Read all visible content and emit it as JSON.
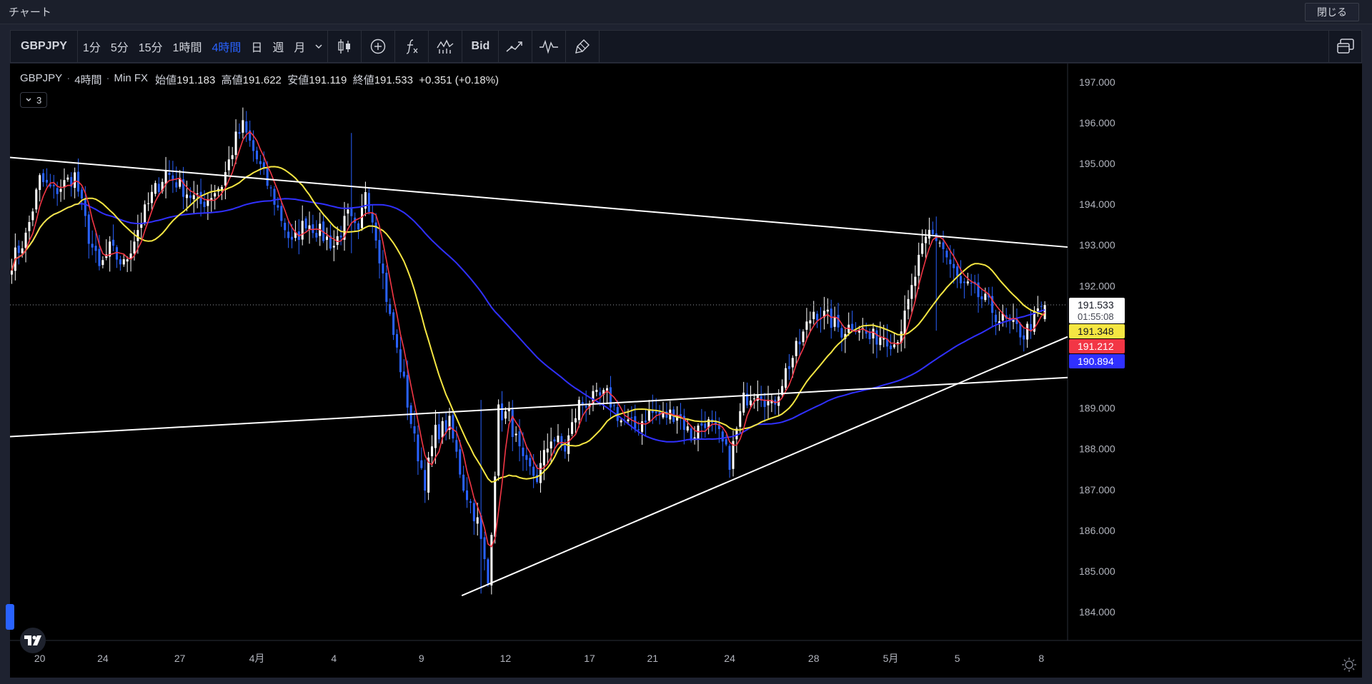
{
  "window": {
    "title": "チャート",
    "close_label": "閉じる"
  },
  "toolbar": {
    "symbol": "GBPJPY",
    "intervals": [
      "1分",
      "5分",
      "15分",
      "1時間",
      "4時間",
      "日",
      "週",
      "月"
    ],
    "active_interval": "4時間",
    "interval_dropdown_icon": "chevron-down-icon",
    "chart_type_icon": "candlestick-icon",
    "add_icon": "plus-circle-icon",
    "indicators_icon": "function-icon",
    "templates_icon": "indicator-templates-icon",
    "bid_label": "Bid",
    "compare_icon": "compare-icon",
    "replay_icon": "bar-replay-icon",
    "clear_icon": "brush-icon",
    "layout_icon": "window-layout-icon"
  },
  "legend": {
    "symbol": "GBPJPY",
    "interval": "4時間",
    "source": "Min FX",
    "open_label": "始値",
    "open": "191.183",
    "high_label": "高値",
    "high": "191.622",
    "low_label": "安値",
    "low": "191.119",
    "close_label": "終値",
    "close": "191.533",
    "change": "+0.351",
    "change_pct": "(+0.18%)",
    "collapse_count": "3"
  },
  "colors": {
    "up": "#ffffff",
    "down": "#2962ff",
    "ma_fast": "#f23645",
    "ma_mid": "#f5e642",
    "ma_slow": "#3030ff",
    "trendline": "#ffffff"
  },
  "chart_data": {
    "type": "candlestick",
    "symbol": "GBPJPY",
    "interval": "4時間",
    "y_ticks": [
      "197.000",
      "196.000",
      "195.000",
      "194.000",
      "193.000",
      "192.000",
      "189.000",
      "188.000",
      "187.000",
      "186.000",
      "185.000",
      "184.000"
    ],
    "ylim": [
      183.3,
      197.4
    ],
    "x_ticks": [
      {
        "label": "20",
        "i": 8
      },
      {
        "label": "24",
        "i": 26
      },
      {
        "label": "27",
        "i": 48
      },
      {
        "label": "4月",
        "i": 70
      },
      {
        "label": "4",
        "i": 92
      },
      {
        "label": "9",
        "i": 117
      },
      {
        "label": "12",
        "i": 141
      },
      {
        "label": "17",
        "i": 165
      },
      {
        "label": "21",
        "i": 183
      },
      {
        "label": "24",
        "i": 205
      },
      {
        "label": "28",
        "i": 229
      },
      {
        "label": "5月",
        "i": 251
      },
      {
        "label": "5",
        "i": 270
      },
      {
        "label": "8",
        "i": 294
      }
    ],
    "price_labels": [
      {
        "name": "last",
        "value": "191.533",
        "countdown": "01:55:08"
      },
      {
        "name": "ma-mid",
        "value": "191.348"
      },
      {
        "name": "ma-fast",
        "value": "191.212"
      },
      {
        "name": "ma-slow",
        "value": "190.894"
      }
    ],
    "trendlines": [
      {
        "name": "upper-resistance",
        "from": [
          0,
          195.15
        ],
        "to": [
          302,
          192.95
        ]
      },
      {
        "name": "middle-line",
        "from": [
          0,
          188.3
        ],
        "to": [
          302,
          189.75
        ]
      },
      {
        "name": "lower-support",
        "from": [
          129,
          184.4
        ],
        "to": [
          302,
          190.75
        ]
      }
    ],
    "anchors": [
      [
        0,
        192.6
      ],
      [
        4,
        193.2
      ],
      [
        8,
        194.6
      ],
      [
        12,
        194.3
      ],
      [
        18,
        194.7
      ],
      [
        22,
        193.2
      ],
      [
        25,
        192.4
      ],
      [
        28,
        192.9
      ],
      [
        32,
        192.5
      ],
      [
        36,
        193.4
      ],
      [
        40,
        194.2
      ],
      [
        44,
        194.8
      ],
      [
        50,
        194.3
      ],
      [
        54,
        194.0
      ],
      [
        60,
        194.5
      ],
      [
        64,
        195.6
      ],
      [
        66,
        195.9
      ],
      [
        70,
        195.1
      ],
      [
        75,
        194.1
      ],
      [
        80,
        193.0
      ],
      [
        84,
        193.6
      ],
      [
        88,
        193.3
      ],
      [
        92,
        193.0
      ],
      [
        96,
        193.7
      ],
      [
        99,
        193.2
      ],
      [
        101,
        194.4
      ],
      [
        104,
        193.3
      ],
      [
        108,
        191.2
      ],
      [
        112,
        189.6
      ],
      [
        115,
        188.2
      ],
      [
        118,
        187.2
      ],
      [
        121,
        188.4
      ],
      [
        125,
        188.6
      ],
      [
        129,
        187.1
      ],
      [
        133,
        186.2
      ],
      [
        136,
        184.7
      ],
      [
        139,
        188.9
      ],
      [
        142,
        188.8
      ],
      [
        146,
        187.6
      ],
      [
        150,
        187.3
      ],
      [
        154,
        188.3
      ],
      [
        158,
        188.0
      ],
      [
        162,
        189.1
      ],
      [
        166,
        189.2
      ],
      [
        170,
        189.3
      ],
      [
        174,
        188.7
      ],
      [
        178,
        188.5
      ],
      [
        182,
        188.9
      ],
      [
        186,
        188.8
      ],
      [
        190,
        188.9
      ],
      [
        194,
        188.3
      ],
      [
        198,
        188.7
      ],
      [
        202,
        188.3
      ],
      [
        205,
        187.7
      ],
      [
        209,
        189.2
      ],
      [
        213,
        189.5
      ],
      [
        217,
        189.0
      ],
      [
        221,
        189.9
      ],
      [
        225,
        190.6
      ],
      [
        229,
        191.4
      ],
      [
        233,
        191.2
      ],
      [
        237,
        190.9
      ],
      [
        241,
        191.1
      ],
      [
        245,
        190.7
      ],
      [
        249,
        190.8
      ],
      [
        252,
        190.6
      ],
      [
        255,
        191.2
      ],
      [
        259,
        192.6
      ],
      [
        262,
        193.3
      ],
      [
        265,
        193.1
      ],
      [
        268,
        192.5
      ],
      [
        271,
        192.0
      ],
      [
        274,
        191.9
      ],
      [
        278,
        191.6
      ],
      [
        282,
        191.2
      ],
      [
        286,
        191.0
      ],
      [
        289,
        190.8
      ],
      [
        292,
        191.2
      ],
      [
        295,
        191.533
      ]
    ],
    "wicks": [
      {
        "i": 97,
        "high": 195.75,
        "low": 192.8
      },
      {
        "i": 134,
        "high": 189.2,
        "low": 184.45
      },
      {
        "i": 264,
        "high": 193.7,
        "low": 190.9
      }
    ],
    "ma_fast_period": 5,
    "ma_mid_period": 20,
    "ma_slow_period": 75
  }
}
